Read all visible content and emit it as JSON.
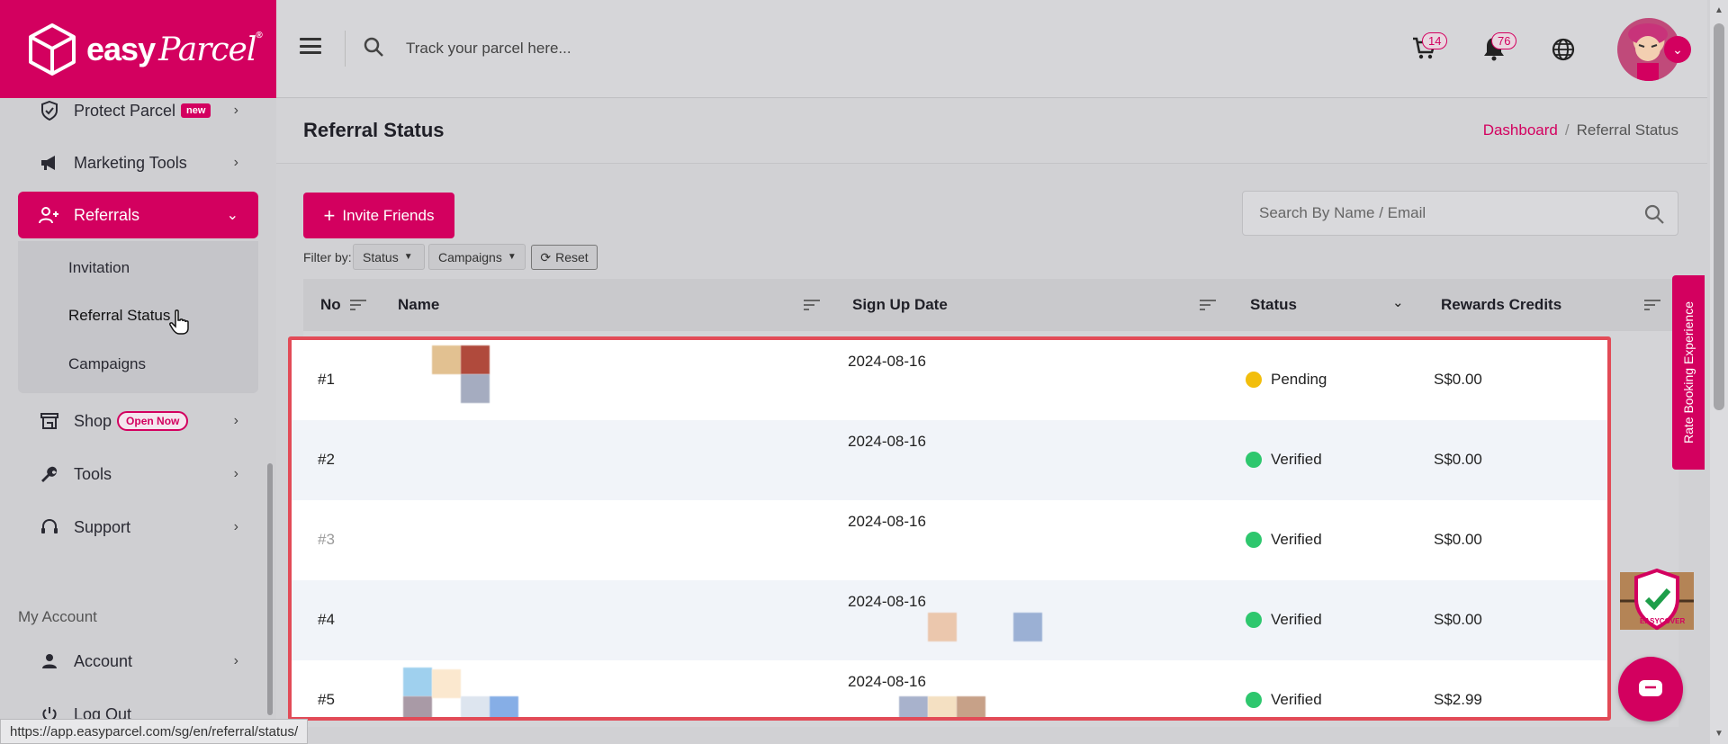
{
  "brand": {
    "name_bold": "easy",
    "name_script": "Parcel",
    "reg": "®",
    "color": "#d3005f"
  },
  "sidebar": {
    "items": [
      {
        "label": "Protect Parcel",
        "badge": "new",
        "icon": "shield-check-icon"
      },
      {
        "label": "Marketing Tools",
        "icon": "megaphone-icon"
      },
      {
        "label": "Referrals",
        "icon": "users-icon",
        "active": true
      },
      {
        "label": "Shop",
        "badge": "Open Now",
        "icon": "store-icon"
      },
      {
        "label": "Tools",
        "icon": "wrench-icon"
      },
      {
        "label": "Support",
        "icon": "headset-icon"
      },
      {
        "label": "Account",
        "icon": "person-icon"
      },
      {
        "label": "Log Out",
        "icon": "power-icon"
      }
    ],
    "referral_submenu": [
      "Invitation",
      "Referral Status",
      "Campaigns"
    ],
    "section_my_account": "My Account"
  },
  "topbar": {
    "search_placeholder": "Track your parcel here...",
    "cart_count": "14",
    "notification_count": "76"
  },
  "page": {
    "title": "Referral Status",
    "breadcrumb": [
      "Dashboard",
      "Referral Status"
    ]
  },
  "toolbar": {
    "invite_label": "Invite Friends",
    "search_placeholder": "Search By Name / Email",
    "filter_label": "Filter by:",
    "status_filter": "Status",
    "campaigns_filter": "Campaigns",
    "reset_label": "Reset"
  },
  "table": {
    "headers": [
      "No",
      "Name",
      "Sign Up Date",
      "Status",
      "Rewards Credits"
    ],
    "rows": [
      {
        "no": "#1",
        "date": "2024-08-16",
        "status": "Pending",
        "credits": "S$0.00"
      },
      {
        "no": "#2",
        "date": "2024-08-16",
        "status": "Verified",
        "credits": "S$0.00"
      },
      {
        "no": "#3",
        "date": "2024-08-16",
        "status": "Verified",
        "credits": "S$0.00"
      },
      {
        "no": "#4",
        "date": "2024-08-16",
        "status": "Verified",
        "credits": "S$0.00"
      },
      {
        "no": "#5",
        "date": "2024-08-16",
        "status": "Verified",
        "credits": "S$2.99"
      }
    ],
    "status_colors": {
      "Pending": "#f2be0c",
      "Verified": "#2ec76e"
    }
  },
  "floaters": {
    "rate_tab": "Rate Booking Experience",
    "shield_label": "EASYCOVER"
  },
  "statusbar": {
    "url": "https://app.easyparcel.com/sg/en/referral/status/"
  }
}
